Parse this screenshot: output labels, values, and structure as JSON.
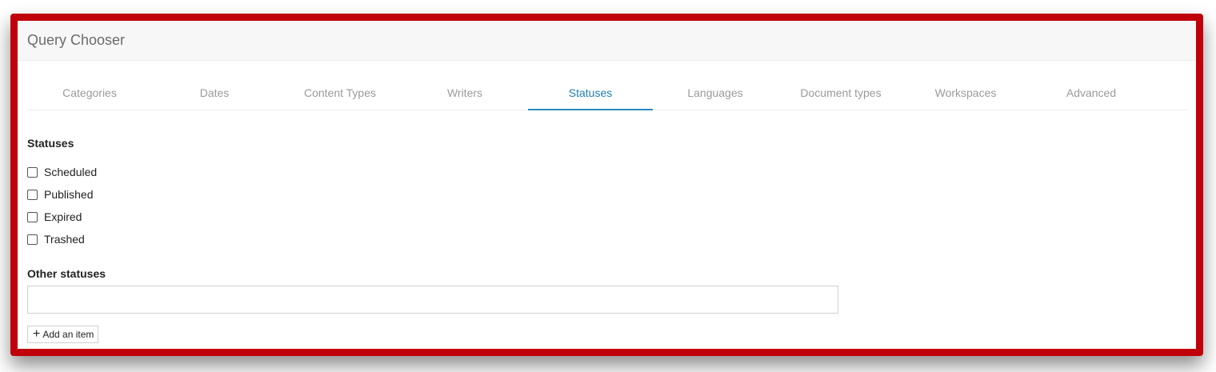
{
  "dialog": {
    "title": "Query Chooser"
  },
  "tabs": [
    {
      "label": "Categories"
    },
    {
      "label": "Dates"
    },
    {
      "label": "Content Types"
    },
    {
      "label": "Writers"
    },
    {
      "label": "Statuses",
      "active": true
    },
    {
      "label": "Languages"
    },
    {
      "label": "Document types"
    },
    {
      "label": "Workspaces"
    },
    {
      "label": "Advanced"
    }
  ],
  "statuses": {
    "heading": "Statuses",
    "options": [
      {
        "label": "Scheduled",
        "checked": false
      },
      {
        "label": "Published",
        "checked": false
      },
      {
        "label": "Expired",
        "checked": false
      },
      {
        "label": "Trashed",
        "checked": false
      }
    ]
  },
  "other_statuses": {
    "heading": "Other statuses",
    "value": "",
    "add_label": "Add an item"
  },
  "colors": {
    "frame": "#c0000a",
    "active_tab": "#1f7fb3"
  }
}
